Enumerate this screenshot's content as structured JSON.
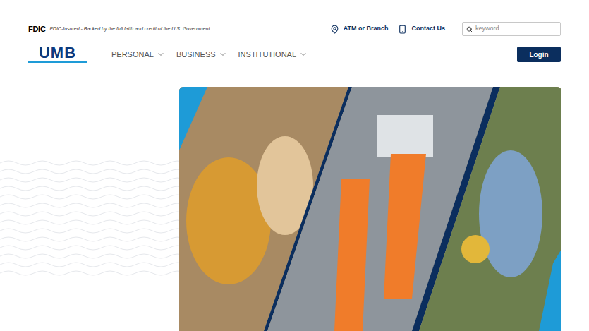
{
  "header": {
    "fdic_logo": "FDIC",
    "fdic_tagline": "FDIC-Insured - Backed by the full faith and credit of the U.S. Government",
    "links": [
      {
        "label": "ATM or Branch",
        "kind": "location"
      },
      {
        "label": "Contact Us",
        "kind": "phone"
      }
    ],
    "search": {
      "placeholder": "keyword",
      "value": ""
    }
  },
  "nav": {
    "logo": "UMB",
    "items": [
      {
        "label": "PERSONAL",
        "expanded": false
      },
      {
        "label": "BUSINESS",
        "expanded": false
      },
      {
        "label": "INSTITUTIONAL",
        "expanded": false
      }
    ],
    "login_button": "Login"
  }
}
